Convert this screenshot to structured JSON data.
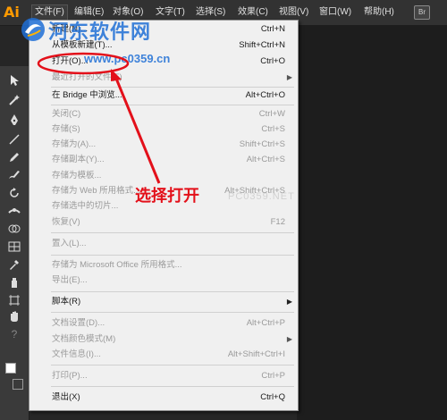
{
  "menubar": {
    "logo": "Ai",
    "items": [
      "文件(F)",
      "编辑(E)",
      "对象(O)",
      "文字(T)",
      "选择(S)",
      "效果(C)",
      "视图(V)",
      "窗口(W)",
      "帮助(H)"
    ],
    "bridge_label": "Br"
  },
  "file_menu": {
    "items": [
      {
        "label": "新建(N)...",
        "shortcut": "Ctrl+N",
        "enabled": true
      },
      {
        "label": "从模板新建(T)...",
        "shortcut": "Shift+Ctrl+N",
        "enabled": true
      },
      {
        "label": "打开(O)...",
        "shortcut": "Ctrl+O",
        "enabled": true
      },
      {
        "label": "最近打开的文件(F)",
        "shortcut": "",
        "enabled": false,
        "submenu": true
      },
      {
        "label": "在 Bridge 中浏览...",
        "shortcut": "Alt+Ctrl+O",
        "enabled": true
      },
      {
        "label": "关闭(C)",
        "shortcut": "Ctrl+W",
        "enabled": false
      },
      {
        "label": "存储(S)",
        "shortcut": "Ctrl+S",
        "enabled": false
      },
      {
        "label": "存储为(A)...",
        "shortcut": "Shift+Ctrl+S",
        "enabled": false
      },
      {
        "label": "存储副本(Y)...",
        "shortcut": "Alt+Ctrl+S",
        "enabled": false
      },
      {
        "label": "存储为模板...",
        "shortcut": "",
        "enabled": false
      },
      {
        "label": "存储为 Web 所用格式...",
        "shortcut": "Alt+Shift+Ctrl+S",
        "enabled": false
      },
      {
        "label": "存储选中的切片...",
        "shortcut": "",
        "enabled": false
      },
      {
        "label": "恢复(V)",
        "shortcut": "F12",
        "enabled": false
      },
      {
        "label": "置入(L)...",
        "shortcut": "",
        "enabled": false
      },
      {
        "label": "存储为 Microsoft Office 所用格式...",
        "shortcut": "",
        "enabled": false
      },
      {
        "label": "导出(E)...",
        "shortcut": "",
        "enabled": false
      },
      {
        "label": "脚本(R)",
        "shortcut": "",
        "enabled": true,
        "submenu": true
      },
      {
        "label": "文档设置(D)...",
        "shortcut": "Alt+Ctrl+P",
        "enabled": false
      },
      {
        "label": "文档颜色模式(M)",
        "shortcut": "",
        "enabled": false,
        "submenu": true
      },
      {
        "label": "文件信息(I)...",
        "shortcut": "Alt+Shift+Ctrl+I",
        "enabled": false
      },
      {
        "label": "打印(P)...",
        "shortcut": "Ctrl+P",
        "enabled": false
      },
      {
        "label": "退出(X)",
        "shortcut": "Ctrl+Q",
        "enabled": true
      }
    ]
  },
  "annotation": {
    "text": "选择打开",
    "color": "#e3101a"
  },
  "watermark": {
    "title": "河东软件网",
    "url": "www.pc0359.cn",
    "faint": "PC0359.NET"
  },
  "colors": {
    "app_bg": "#262626",
    "menubar_bg": "#323232",
    "menu_bg": "#f0f0f0",
    "ai_orange": "#ff9a00",
    "watermark_blue": "#1f6fd6"
  }
}
